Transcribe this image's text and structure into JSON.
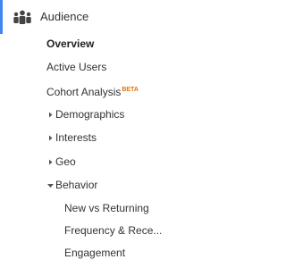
{
  "section": {
    "label": "Audience",
    "icon": "audience-icon",
    "accent_color": "#4285f4"
  },
  "items": [
    {
      "label": "Overview",
      "active": true
    },
    {
      "label": "Active Users"
    },
    {
      "label": "Cohort Analysis",
      "badge": "BETA",
      "badge_color": "#e8710a"
    },
    {
      "label": "Demographics",
      "expander": "collapsed"
    },
    {
      "label": "Interests",
      "expander": "collapsed"
    },
    {
      "label": "Geo",
      "expander": "collapsed"
    },
    {
      "label": "Behavior",
      "expander": "expanded"
    }
  ],
  "behavior_subitems": [
    {
      "label": "New vs Returning"
    },
    {
      "label": "Frequency & Rece..."
    },
    {
      "label": "Engagement"
    }
  ]
}
